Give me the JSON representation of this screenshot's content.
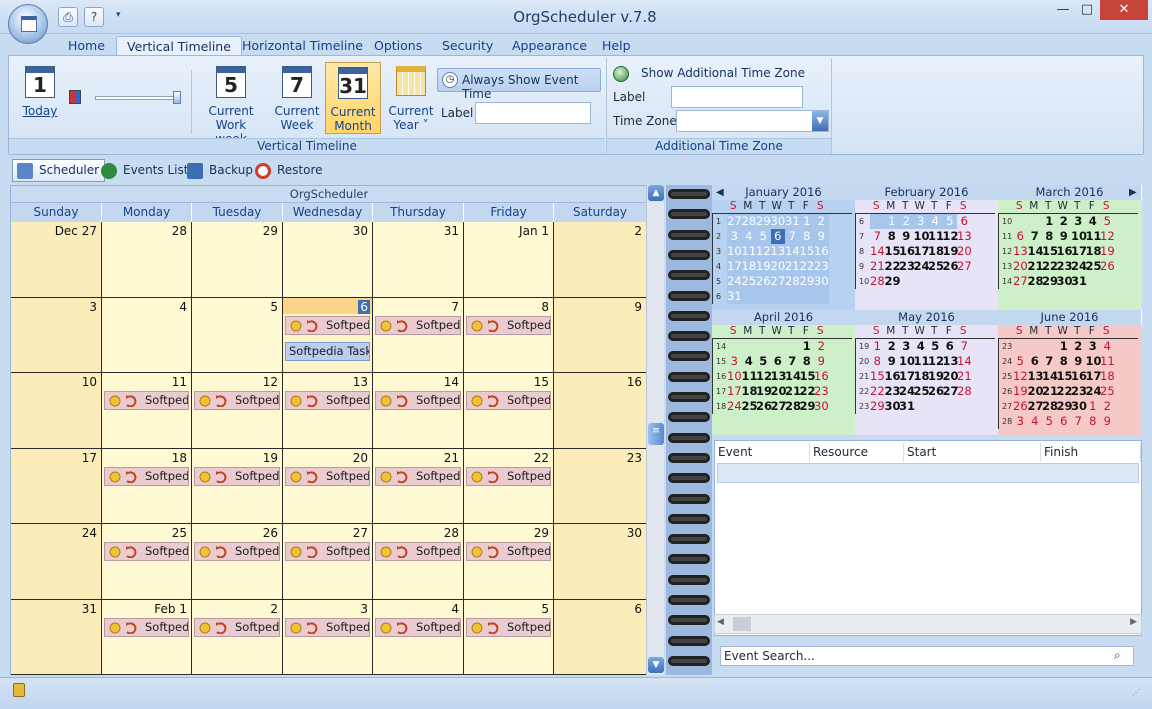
{
  "window": {
    "title": "OrgScheduler v.7.8",
    "minimize": "—",
    "maximize": "□",
    "close": "✕"
  },
  "menu_tabs": [
    {
      "label": "Home"
    },
    {
      "label": "Vertical Timeline"
    },
    {
      "label": "Horizontal Timeline"
    },
    {
      "label": "Options"
    },
    {
      "label": "Security"
    },
    {
      "label": "Appearance"
    },
    {
      "label": "Help"
    }
  ],
  "ribbon": {
    "today": {
      "icon_num": "1",
      "label": "Today"
    },
    "work_week": {
      "icon_num": "5",
      "label1": "Current",
      "label2": "Work week"
    },
    "week": {
      "icon_num": "7",
      "label1": "Current",
      "label2": "Week"
    },
    "month": {
      "icon_num": "31",
      "label1": "Current",
      "label2": "Month"
    },
    "year": {
      "label1": "Current",
      "label2": "Year ˅"
    },
    "always_show": "Always Show Event Time",
    "label_field": "Label",
    "group_vertical": "Vertical Timeline",
    "show_tz": "Show Additional Time Zone",
    "tz_label": "Label",
    "tz_zone": "Time Zone",
    "group_tz": "Additional Time Zone"
  },
  "subtoolbar": [
    {
      "label": "Scheduler",
      "color": "#5b86c9"
    },
    {
      "label": "Events List",
      "color": "#2f8a3d"
    },
    {
      "label": "Backup",
      "color": "#3b6fb1"
    },
    {
      "label": "Restore",
      "color": "#d23a2a"
    }
  ],
  "scheduler": {
    "title": "OrgScheduler",
    "days": [
      "Sunday",
      "Monday",
      "Tuesday",
      "Wednesday",
      "Thursday",
      "Friday",
      "Saturday"
    ],
    "weeks": [
      [
        "Dec 27",
        "28",
        "29",
        "30",
        "31",
        "Jan 1",
        "2"
      ],
      [
        "3",
        "4",
        "5",
        "6",
        "7",
        "8",
        "9"
      ],
      [
        "10",
        "11",
        "12",
        "13",
        "14",
        "15",
        "16"
      ],
      [
        "17",
        "18",
        "19",
        "20",
        "21",
        "22",
        "23"
      ],
      [
        "24",
        "25",
        "26",
        "27",
        "28",
        "29",
        "30"
      ],
      [
        "31",
        "Feb 1",
        "2",
        "3",
        "4",
        "5",
        "6"
      ]
    ],
    "event_text": "Softpedia",
    "task_text": "Softpedia Task (S"
  },
  "mini_months": [
    {
      "name": "January 2016",
      "color": "#b7d2f0",
      "big": "1",
      "weeks": [
        "1",
        "2",
        "3",
        "4",
        "5",
        "6"
      ],
      "rows": [
        [
          "27",
          "28",
          "29",
          "30",
          "31",
          "1",
          "2"
        ],
        [
          "3",
          "4",
          "5",
          "6",
          "7",
          "8",
          "9"
        ],
        [
          "10",
          "11",
          "12",
          "13",
          "14",
          "15",
          "16"
        ],
        [
          "17",
          "18",
          "19",
          "20",
          "21",
          "22",
          "23"
        ],
        [
          "24",
          "25",
          "26",
          "27",
          "28",
          "29",
          "30"
        ],
        [
          "31",
          "",
          "",
          "",
          "",
          "",
          ""
        ]
      ]
    },
    {
      "name": "February 2016",
      "color": "#e8e4f7",
      "big": "2",
      "weeks": [
        "6",
        "7",
        "8",
        "9",
        "10"
      ],
      "rows": [
        [
          "",
          "1",
          "2",
          "3",
          "4",
          "5",
          "6"
        ],
        [
          "7",
          "8",
          "9",
          "10",
          "11",
          "12",
          "13"
        ],
        [
          "14",
          "15",
          "16",
          "17",
          "18",
          "19",
          "20"
        ],
        [
          "21",
          "22",
          "23",
          "24",
          "25",
          "26",
          "27"
        ],
        [
          "28",
          "29",
          "",
          "",
          "",
          "",
          ""
        ]
      ]
    },
    {
      "name": "March 2016",
      "color": "#cdf0c8",
      "big": "3",
      "weeks": [
        "10",
        "11",
        "12",
        "13",
        "14"
      ],
      "rows": [
        [
          "",
          "",
          "1",
          "2",
          "3",
          "4",
          "5"
        ],
        [
          "6",
          "7",
          "8",
          "9",
          "10",
          "11",
          "12"
        ],
        [
          "13",
          "14",
          "15",
          "16",
          "17",
          "18",
          "19"
        ],
        [
          "20",
          "21",
          "22",
          "23",
          "24",
          "25",
          "26"
        ],
        [
          "27",
          "28",
          "29",
          "30",
          "31",
          "",
          ""
        ]
      ]
    },
    {
      "name": "April 2016",
      "color": "#cdf0c8",
      "big": "4",
      "weeks": [
        "14",
        "15",
        "16",
        "17",
        "18"
      ],
      "rows": [
        [
          "",
          "",
          "",
          "",
          "",
          "1",
          "2"
        ],
        [
          "3",
          "4",
          "5",
          "6",
          "7",
          "8",
          "9"
        ],
        [
          "10",
          "11",
          "12",
          "13",
          "14",
          "15",
          "16"
        ],
        [
          "17",
          "18",
          "19",
          "20",
          "21",
          "22",
          "23"
        ],
        [
          "24",
          "25",
          "26",
          "27",
          "28",
          "29",
          "30"
        ]
      ]
    },
    {
      "name": "May 2016",
      "color": "#e8e4f7",
      "big": "5",
      "weeks": [
        "19",
        "20",
        "21",
        "22",
        "23"
      ],
      "rows": [
        [
          "1",
          "2",
          "3",
          "4",
          "5",
          "6",
          "7"
        ],
        [
          "8",
          "9",
          "10",
          "11",
          "12",
          "13",
          "14"
        ],
        [
          "15",
          "16",
          "17",
          "18",
          "19",
          "20",
          "21"
        ],
        [
          "22",
          "23",
          "24",
          "25",
          "26",
          "27",
          "28"
        ],
        [
          "29",
          "30",
          "31",
          "",
          "",
          "",
          ""
        ]
      ]
    },
    {
      "name": "June 2016",
      "color": "#f6c9c9",
      "big": "6",
      "weeks": [
        "23",
        "24",
        "25",
        "26",
        "27",
        "28"
      ],
      "rows": [
        [
          "",
          "",
          "",
          "1",
          "2",
          "3",
          "4"
        ],
        [
          "5",
          "6",
          "7",
          "8",
          "9",
          "10",
          "11"
        ],
        [
          "12",
          "13",
          "14",
          "15",
          "16",
          "17",
          "18"
        ],
        [
          "19",
          "20",
          "21",
          "22",
          "23",
          "24",
          "25"
        ],
        [
          "26",
          "27",
          "28",
          "29",
          "30",
          "1",
          "2"
        ],
        [
          "3",
          "4",
          "5",
          "6",
          "7",
          "8",
          "9"
        ]
      ]
    }
  ],
  "mini_dow": [
    "S",
    "M",
    "T",
    "W",
    "T",
    "F",
    "S"
  ],
  "list": {
    "columns": [
      "Event",
      "Resource",
      "Start",
      "Finish"
    ],
    "search_placeholder": "Event Search..."
  }
}
